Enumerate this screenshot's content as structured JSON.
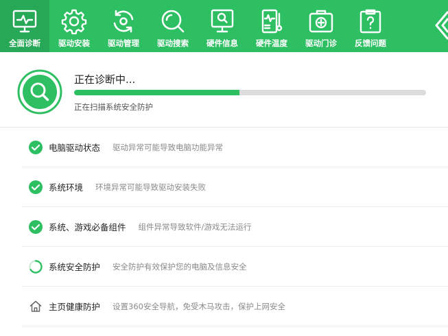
{
  "toolbar": {
    "items": [
      {
        "label": "全面诊断",
        "icon": "monitor-pulse-icon",
        "active": true
      },
      {
        "label": "驱动安装",
        "icon": "gear-icon"
      },
      {
        "label": "驱动管理",
        "icon": "refresh-icon"
      },
      {
        "label": "驱动搜索",
        "icon": "search-icon"
      },
      {
        "label": "硬件信息",
        "icon": "monitor-user-icon"
      },
      {
        "label": "硬件温度",
        "icon": "thermometer-icon"
      },
      {
        "label": "驱动门诊",
        "icon": "medical-kit-icon"
      },
      {
        "label": "反馈问题",
        "icon": "clipboard-question-icon"
      }
    ],
    "active_color": "#27a857",
    "bar_color": "#2ebf63"
  },
  "status": {
    "title": "正在诊断中...",
    "subtitle": "正在扫描系统安全防护",
    "progress": 0.47
  },
  "items": [
    {
      "name": "电脑驱动状态",
      "desc": "驱动异常可能导致电脑功能异常",
      "state": "done",
      "icon": "check-circle-icon"
    },
    {
      "name": "系统环境",
      "desc": "环境异常可能导致驱动安装失败",
      "state": "done",
      "icon": "check-circle-icon"
    },
    {
      "name": "系统、游戏必备组件",
      "desc": "组件异常导致软件/游戏无法运行",
      "state": "done",
      "icon": "check-circle-icon"
    },
    {
      "name": "系统安全防护",
      "desc": "安全防护有效保护您的电脑及信息安全",
      "state": "scanning",
      "icon": "loading-spinner-icon"
    },
    {
      "name": "主页健康防护",
      "desc": "设置360安全导航，免受木马攻击，保护上网安全",
      "state": "pending",
      "icon": "home-icon"
    }
  ]
}
